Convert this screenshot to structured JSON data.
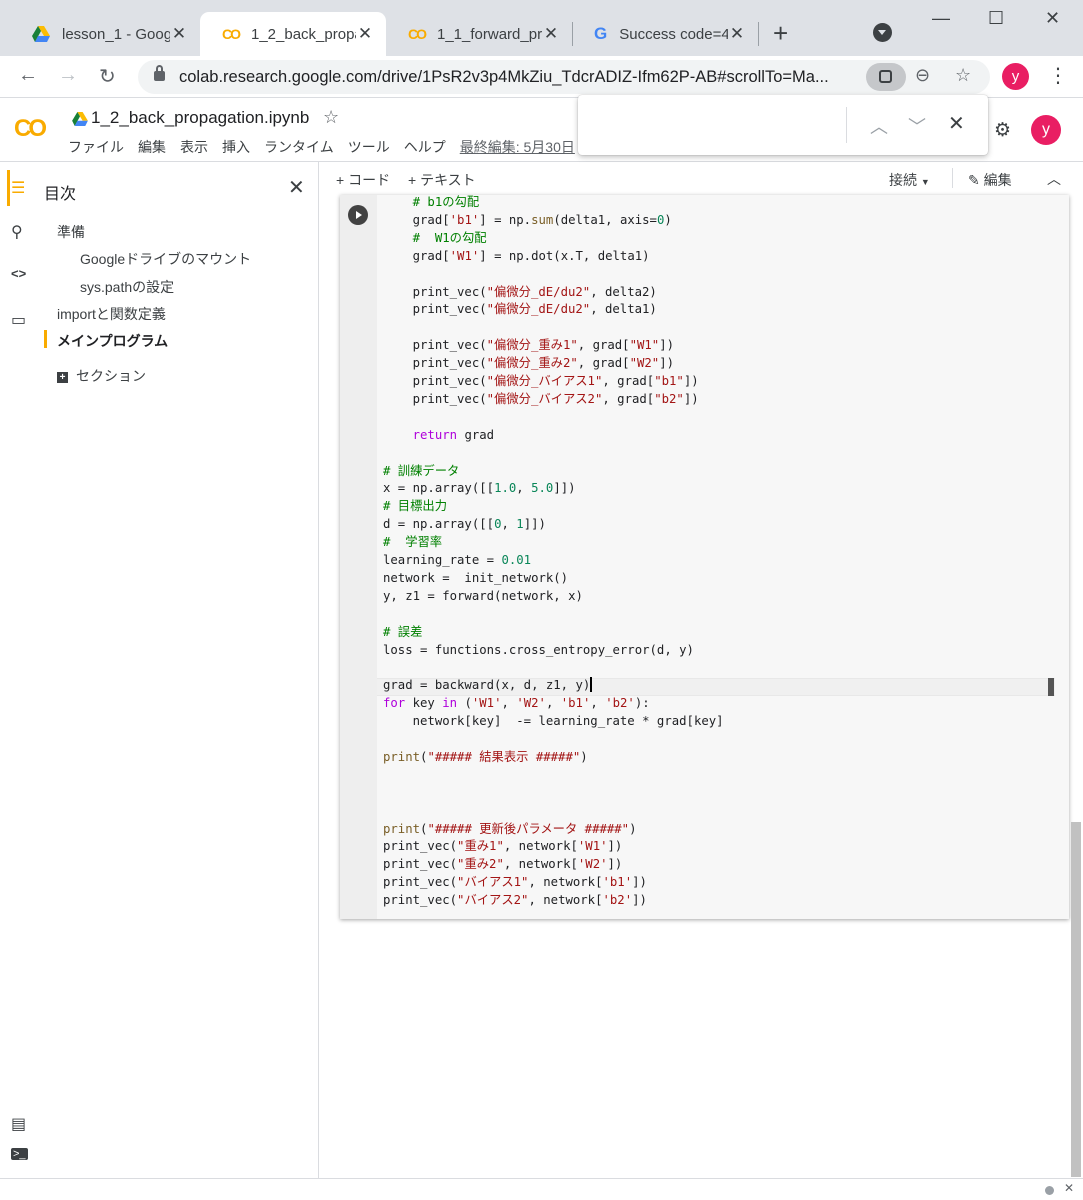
{
  "browser": {
    "tabs": [
      {
        "title": "lesson_1 - Goog",
        "icon": "google-drive-icon"
      },
      {
        "title": "1_2_back_propa",
        "icon": "colab-icon"
      },
      {
        "title": "1_1_forward_pro",
        "icon": "colab-icon"
      },
      {
        "title": "Success code=4",
        "icon": "google-g-icon"
      }
    ],
    "new_tab": "+",
    "close_glyph": "✕",
    "url": "colab.research.google.com/drive/1PsR2v3p4MkZiu_TdcrADIZ-Ifm62P-AB#scrollTo=Ma...",
    "profile_initial": "y",
    "window_controls": {
      "minimize": "—",
      "maximize": "☐",
      "close": "✕"
    },
    "nav": {
      "back": "←",
      "forward": "→",
      "reload": "↻"
    }
  },
  "colab": {
    "logo": "CO",
    "notebook_title": "1_2_back_propagation.ipynb",
    "star": "☆",
    "menu": [
      "ファイル",
      "編集",
      "表示",
      "挿入",
      "ランタイム",
      "ツール",
      "ヘルプ"
    ],
    "last_edit": "最終編集: 5月30日",
    "profile_initial": "y",
    "find": {
      "up": "︿",
      "down": "﹀",
      "close": "✕"
    }
  },
  "sidebar": {
    "title": "目次",
    "close": "✕",
    "items": [
      {
        "label": "準備",
        "level": 1
      },
      {
        "label": "Googleドライブのマウント",
        "level": 2
      },
      {
        "label": "sys.pathの設定",
        "level": 2
      },
      {
        "label": "importと関数定義",
        "level": 1
      },
      {
        "label": "メインプログラム",
        "level": 1,
        "active": true
      },
      {
        "label": "セクション",
        "level": 1,
        "add": true
      }
    ]
  },
  "notebook_toolbar": {
    "add_code": "+ コード",
    "add_text": "+ テキスト",
    "connect": "接続",
    "edit": "編集"
  },
  "code_lines": [
    [
      [
        "    ",
        ""
      ],
      [
        "# b1の勾配",
        "cmt"
      ]
    ],
    [
      [
        "    grad[",
        ""
      ],
      [
        "'b1'",
        "str"
      ],
      [
        "] = np.",
        ""
      ],
      [
        "sum",
        "bi"
      ],
      [
        "(delta1, axis=",
        ""
      ],
      [
        "0",
        "num"
      ],
      [
        ")",
        ""
      ]
    ],
    [
      [
        "    ",
        ""
      ],
      [
        "#  W1の勾配",
        "cmt"
      ]
    ],
    [
      [
        "    grad[",
        ""
      ],
      [
        "'W1'",
        "str"
      ],
      [
        "] = np.dot(x.T, delta1)",
        ""
      ]
    ],
    [
      [
        "",
        ""
      ]
    ],
    [
      [
        "    print_vec(",
        ""
      ],
      [
        "\"偏微分_dE/du2\"",
        "str"
      ],
      [
        ", delta2)",
        ""
      ]
    ],
    [
      [
        "    print_vec(",
        ""
      ],
      [
        "\"偏微分_dE/du2\"",
        "str"
      ],
      [
        ", delta1)",
        ""
      ]
    ],
    [
      [
        "",
        ""
      ]
    ],
    [
      [
        "    print_vec(",
        ""
      ],
      [
        "\"偏微分_重み1\"",
        "str"
      ],
      [
        ", grad[",
        ""
      ],
      [
        "\"W1\"",
        "str"
      ],
      [
        "])",
        ""
      ]
    ],
    [
      [
        "    print_vec(",
        ""
      ],
      [
        "\"偏微分_重み2\"",
        "str"
      ],
      [
        ", grad[",
        ""
      ],
      [
        "\"W2\"",
        "str"
      ],
      [
        "])",
        ""
      ]
    ],
    [
      [
        "    print_vec(",
        ""
      ],
      [
        "\"偏微分_バイアス1\"",
        "str"
      ],
      [
        ", grad[",
        ""
      ],
      [
        "\"b1\"",
        "str"
      ],
      [
        "])",
        ""
      ]
    ],
    [
      [
        "    print_vec(",
        ""
      ],
      [
        "\"偏微分_バイアス2\"",
        "str"
      ],
      [
        ", grad[",
        ""
      ],
      [
        "\"b2\"",
        "str"
      ],
      [
        "])",
        ""
      ]
    ],
    [
      [
        "",
        ""
      ]
    ],
    [
      [
        "    ",
        ""
      ],
      [
        "return",
        "kw"
      ],
      [
        " grad",
        ""
      ]
    ],
    [
      [
        "",
        ""
      ]
    ],
    [
      [
        "# 訓練データ",
        "cmt"
      ]
    ],
    [
      [
        "x = np.array([[",
        ""
      ],
      [
        "1.0",
        "num"
      ],
      [
        ", ",
        ""
      ],
      [
        "5.0",
        "num"
      ],
      [
        "]])",
        ""
      ]
    ],
    [
      [
        "# 目標出力",
        "cmt"
      ]
    ],
    [
      [
        "d = np.array([[",
        ""
      ],
      [
        "0",
        "num"
      ],
      [
        ", ",
        ""
      ],
      [
        "1",
        "num"
      ],
      [
        "]])",
        ""
      ]
    ],
    [
      [
        "#  学習率",
        "cmt"
      ]
    ],
    [
      [
        "learning_rate = ",
        ""
      ],
      [
        "0.01",
        "num"
      ]
    ],
    [
      [
        "network =  init_network()",
        ""
      ]
    ],
    [
      [
        "y, z1 = forward(network, x)",
        ""
      ]
    ],
    [
      [
        "",
        ""
      ]
    ],
    [
      [
        "# 誤差",
        "cmt"
      ]
    ],
    [
      [
        "loss = functions.cross_entropy_error(d, y)",
        ""
      ]
    ],
    [
      [
        "",
        ""
      ]
    ],
    [
      [
        "grad = backward(x, d, z1, y)",
        ""
      ],
      [
        "",
        "caret"
      ]
    ],
    [
      [
        "for",
        "kw"
      ],
      [
        " key ",
        ""
      ],
      [
        "in",
        "kw"
      ],
      [
        " (",
        ""
      ],
      [
        "'W1'",
        "str"
      ],
      [
        ", ",
        ""
      ],
      [
        "'W2'",
        "str"
      ],
      [
        ", ",
        ""
      ],
      [
        "'b1'",
        "str"
      ],
      [
        ", ",
        ""
      ],
      [
        "'b2'",
        "str"
      ],
      [
        "):",
        ""
      ]
    ],
    [
      [
        "    network[key]  -= learning_rate * grad[key]",
        ""
      ]
    ],
    [
      [
        "",
        ""
      ]
    ],
    [
      [
        "print",
        "bi"
      ],
      [
        "(",
        ""
      ],
      [
        "\"##### 結果表示 #####\"",
        "str"
      ],
      [
        ")",
        ""
      ]
    ],
    [
      [
        "",
        ""
      ]
    ],
    [
      [
        "",
        ""
      ]
    ],
    [
      [
        "",
        ""
      ]
    ],
    [
      [
        "print",
        "bi"
      ],
      [
        "(",
        ""
      ],
      [
        "\"##### 更新後パラメータ #####\"",
        "str"
      ],
      [
        ")",
        ""
      ]
    ],
    [
      [
        "print_vec(",
        ""
      ],
      [
        "\"重み1\"",
        "str"
      ],
      [
        ", network[",
        ""
      ],
      [
        "'W1'",
        "str"
      ],
      [
        "])",
        ""
      ]
    ],
    [
      [
        "print_vec(",
        ""
      ],
      [
        "\"重み2\"",
        "str"
      ],
      [
        ", network[",
        ""
      ],
      [
        "'W2'",
        "str"
      ],
      [
        "])",
        ""
      ]
    ],
    [
      [
        "print_vec(",
        ""
      ],
      [
        "\"バイアス1\"",
        "str"
      ],
      [
        ", network[",
        ""
      ],
      [
        "'b1'",
        "str"
      ],
      [
        "])",
        ""
      ]
    ],
    [
      [
        "print_vec(",
        ""
      ],
      [
        "\"バイアス2\"",
        "str"
      ],
      [
        ", network[",
        ""
      ],
      [
        "'b2'",
        "str"
      ],
      [
        "])",
        ""
      ]
    ]
  ],
  "colors": {
    "colab_orange": "#f9ab00",
    "avatar_pink": "#e91e63",
    "comment": "#008000",
    "string": "#a31515",
    "number": "#098658",
    "keyword": "#af00db"
  }
}
